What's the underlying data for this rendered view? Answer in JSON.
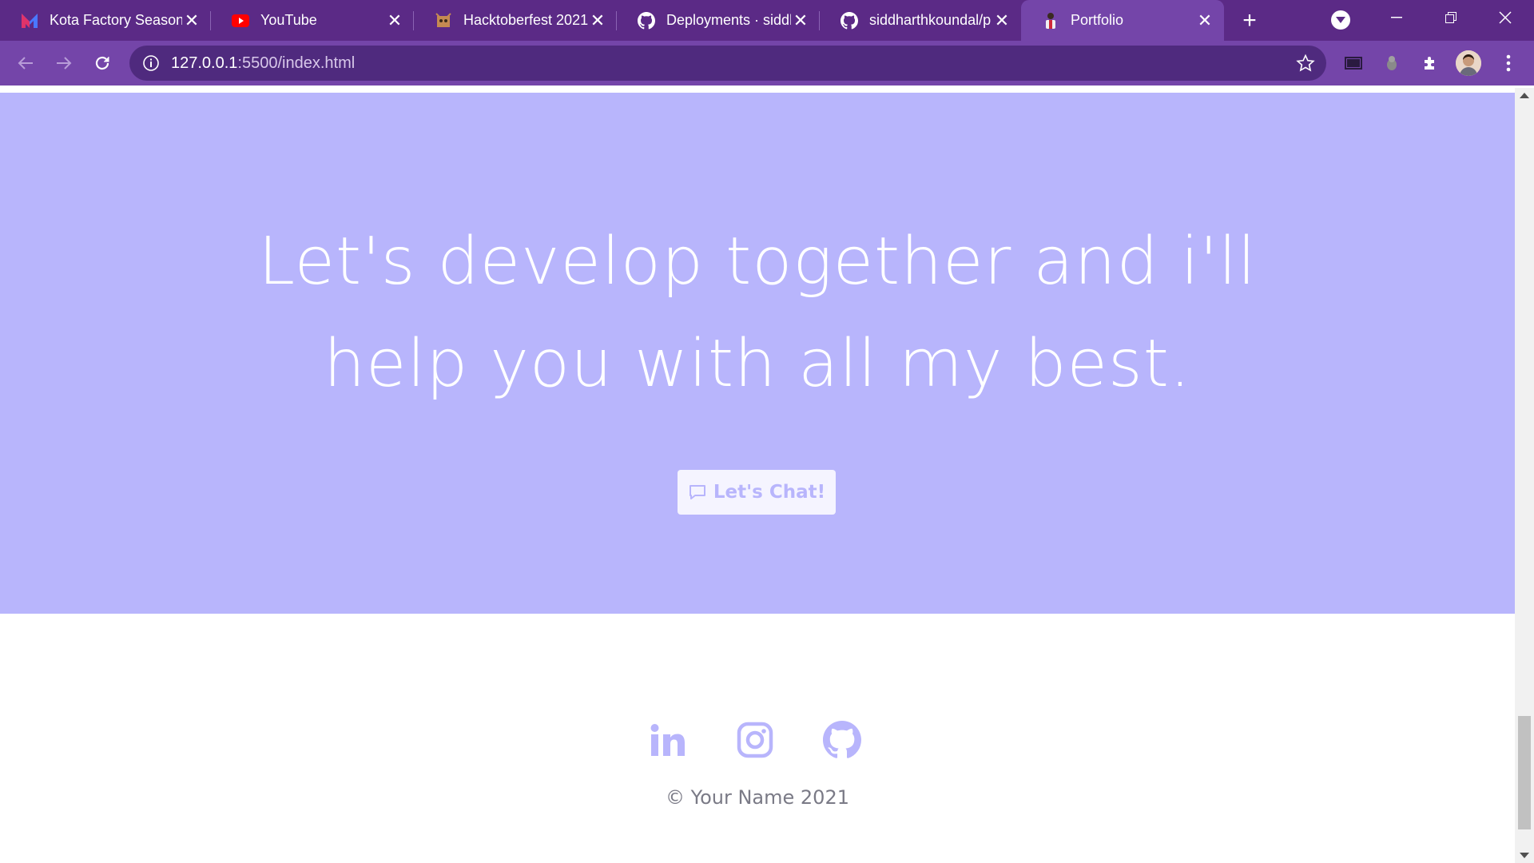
{
  "browser": {
    "tabs": [
      {
        "title": "Kota Factory Season",
        "favicon": "m-logo-icon"
      },
      {
        "title": "YouTube",
        "favicon": "youtube-icon"
      },
      {
        "title": "Hacktoberfest 2021",
        "favicon": "hacktoberfest-icon"
      },
      {
        "title": "Deployments · siddl",
        "favicon": "github-icon"
      },
      {
        "title": "siddharthkoundal/p",
        "favicon": "github-icon"
      },
      {
        "title": "Portfolio",
        "favicon": "portfolio-icon",
        "active": true
      }
    ],
    "url_host": "127.0.0.1",
    "url_path": ":5500/index.html"
  },
  "hero": {
    "headline_line1": "Let's develop together and i'll",
    "headline_line2": "help you with all my best.",
    "cta_label": "Let's Chat!"
  },
  "footer": {
    "social": [
      "linkedin-icon",
      "instagram-icon",
      "github-icon"
    ],
    "copyright": "© Your Name 2021"
  },
  "colors": {
    "tab_strip": "#5b2a86",
    "toolbar": "#7445a9",
    "hero_bg": "#b8b5fc",
    "accent": "#b8b5fc"
  }
}
